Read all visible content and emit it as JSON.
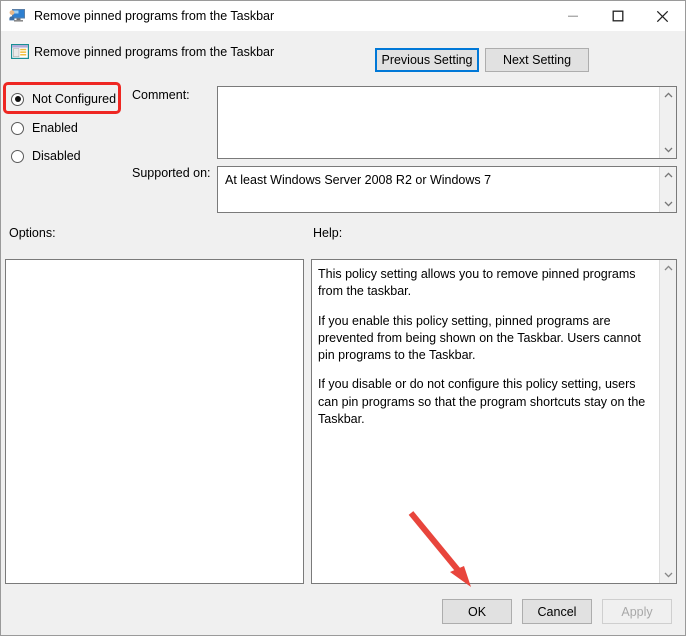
{
  "window": {
    "title": "Remove pinned programs from the Taskbar",
    "title_icon": "computer-monitor-icon",
    "controls": {
      "minimize": "minimize-icon",
      "maximize": "maximize-icon",
      "close": "close-icon"
    }
  },
  "header": {
    "icon": "policy-setting-icon",
    "title": "Remove pinned programs from the Taskbar",
    "previous_button": "Previous Setting",
    "next_button": "Next Setting"
  },
  "state_options": [
    {
      "label": "Not Configured",
      "selected": true
    },
    {
      "label": "Enabled",
      "selected": false
    },
    {
      "label": "Disabled",
      "selected": false
    }
  ],
  "fields": {
    "comment_label": "Comment:",
    "comment_value": "",
    "supported_label": "Supported on:",
    "supported_value": "At least Windows Server 2008 R2 or Windows 7"
  },
  "panels": {
    "options_label": "Options:",
    "options_value": "",
    "help_label": "Help:",
    "help_paragraphs": [
      "This policy setting allows you to remove pinned programs from the taskbar.",
      "If you enable this policy setting, pinned programs are prevented from being shown on the Taskbar. Users cannot pin programs to the Taskbar.",
      "If you disable or do not configure this policy setting, users can pin programs so that the program shortcuts stay on the Taskbar."
    ]
  },
  "footer": {
    "ok": "OK",
    "cancel": "Cancel",
    "apply": "Apply",
    "apply_enabled": false
  },
  "annotation": {
    "arrow_color": "#e8453c",
    "points_to": "ok-button"
  },
  "colors": {
    "focus_blue": "#0078d7",
    "highlight_red": "#ee2722",
    "window_bg": "#f0f0f0",
    "field_bg": "#ffffff"
  }
}
